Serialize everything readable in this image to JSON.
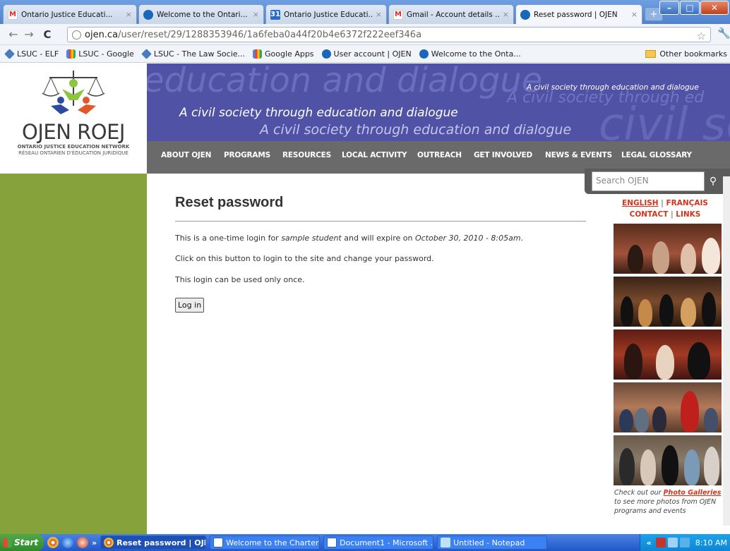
{
  "browser": {
    "tabs": [
      {
        "title": "Ontario Justice Educati...",
        "favicon": "gmail-icon",
        "active": false
      },
      {
        "title": "Welcome to the Ontari...",
        "favicon": "ojen-icon",
        "active": false
      },
      {
        "title": "Ontario Justice Educati...",
        "favicon": "calendar-icon",
        "active": false
      },
      {
        "title": "Gmail - Account details ...",
        "favicon": "gmail-icon",
        "active": false
      },
      {
        "title": "Reset password | OJEN",
        "favicon": "ojen-icon",
        "active": true
      }
    ],
    "url_host": "ojen.ca",
    "url_path": "/user/reset/29/1288353946/1a6feba0a44f20b4e6372f222eef346a",
    "bookmarks": [
      "LSUC - ELF",
      "LSUC - Google",
      "LSUC - The Law Socie...",
      "Google Apps",
      "User account | OJEN",
      "Welcome to the Onta..."
    ],
    "other_bookmarks": "Other bookmarks"
  },
  "site": {
    "logo_main": "OJEN ROEJ",
    "logo_line1": "ONTARIO JUSTICE EDUCATION NETWORK",
    "logo_line2": "RÉSEAU ONTARIEN D'ÉDUCATION JURIDIQUE",
    "banner_watermark": "education and dialogue",
    "banner_tag_small": "A civil society through education and dialogue",
    "banner_tag_wm": "A civil society through ed",
    "banner_tag_wm_big": "civil soc",
    "banner_tag1": "A civil society through education and dialogue",
    "banner_tag2": "A civil society through education and dialogue",
    "menu": [
      "ABOUT OJEN",
      "PROGRAMS",
      "RESOURCES",
      "LOCAL ACTIVITY",
      "OUTREACH",
      "GET INVOLVED",
      "NEWS & EVENTS",
      "LEGAL GLOSSARY"
    ],
    "search_placeholder": "Search OJEN",
    "lang_english": "ENGLISH",
    "lang_french": "FRANÇAIS",
    "contact": "CONTACT",
    "links": "LINKS",
    "gallery_pre": "Check out our ",
    "gallery_link": "Photo Galleries",
    "gallery_post": " to see more photos from OJEN programs and events"
  },
  "content": {
    "title": "Reset password",
    "p1_pre": "This is a one-time login for ",
    "p1_user": "sample student",
    "p1_mid": " and will expire on ",
    "p1_date": "October 30, 2010 - 8:05am",
    "p1_end": ".",
    "p2": "Click on this button to login to the site and change your password.",
    "p3": "This login can be used only once.",
    "login_button": "Log in"
  },
  "taskbar": {
    "start": "Start",
    "tasks": [
      {
        "label": "Reset password | OJE...",
        "active": true
      },
      {
        "label": "Welcome to the Charter ...",
        "active": false
      },
      {
        "label": "Document1 - Microsoft ...",
        "active": false
      },
      {
        "label": "Untitled - Notepad",
        "active": false
      }
    ],
    "overflow": "»",
    "tray_chevron": "«",
    "clock": "8:10 AM"
  }
}
